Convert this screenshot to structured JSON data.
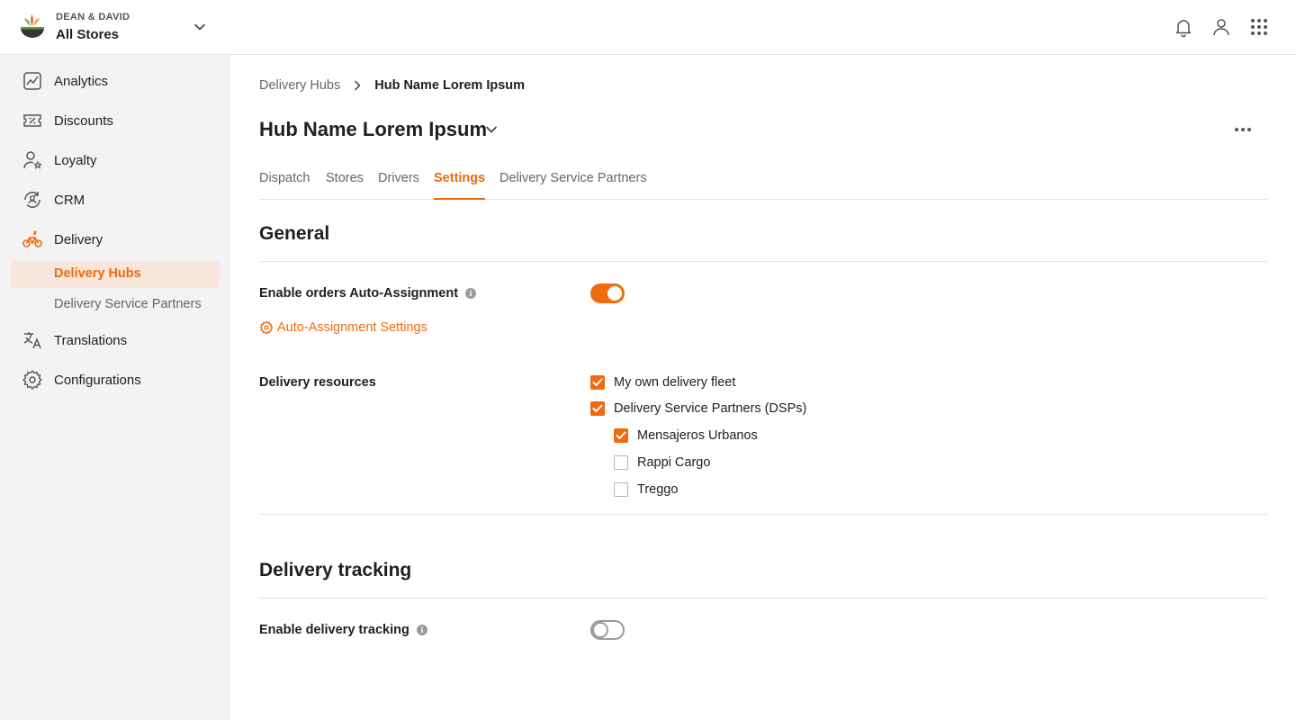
{
  "header": {
    "brand_small": "DEAN & DAVID",
    "store_name": "All Stores"
  },
  "sidebar": {
    "items": [
      {
        "label": "Analytics",
        "icon": "analytics-icon"
      },
      {
        "label": "Discounts",
        "icon": "discount-icon"
      },
      {
        "label": "Loyalty",
        "icon": "loyalty-icon"
      },
      {
        "label": "CRM",
        "icon": "crm-icon"
      },
      {
        "label": "Delivery",
        "icon": "bike-icon"
      },
      {
        "label": "Translations",
        "icon": "translate-icon"
      },
      {
        "label": "Configurations",
        "icon": "gear-icon"
      }
    ],
    "delivery_sub": [
      {
        "label": "Delivery Hubs",
        "active": true
      },
      {
        "label": "Delivery Service Partners",
        "active": false
      }
    ]
  },
  "breadcrumb": {
    "parent": "Delivery Hubs",
    "current": "Hub Name Lorem Ipsum"
  },
  "page": {
    "title": "Hub Name Lorem Ipsum"
  },
  "tabs": [
    {
      "label": "Dispatch"
    },
    {
      "label": "Stores"
    },
    {
      "label": "Drivers"
    },
    {
      "label": "Settings",
      "active": true
    },
    {
      "label": "Delivery Service Partners"
    }
  ],
  "general": {
    "title": "General",
    "auto_assign_label": "Enable orders Auto-Assignment",
    "auto_assign_enabled": true,
    "auto_assign_link": "Auto-Assignment Settings",
    "resources_label": "Delivery resources",
    "resources": [
      {
        "label": "My own delivery fleet",
        "checked": true
      },
      {
        "label": "Delivery Service Partners (DSPs)",
        "checked": true
      }
    ],
    "dsps": [
      {
        "label": "Mensajeros Urbanos",
        "checked": true
      },
      {
        "label": "Rappi Cargo",
        "checked": false
      },
      {
        "label": "Treggo",
        "checked": false
      }
    ]
  },
  "tracking": {
    "title": "Delivery tracking",
    "enable_label": "Enable delivery tracking",
    "enabled": false
  },
  "colors": {
    "accent": "#ef6a10",
    "sidebar_bg": "#f3f3f3",
    "active_sub_bg": "#f7e6dc"
  }
}
